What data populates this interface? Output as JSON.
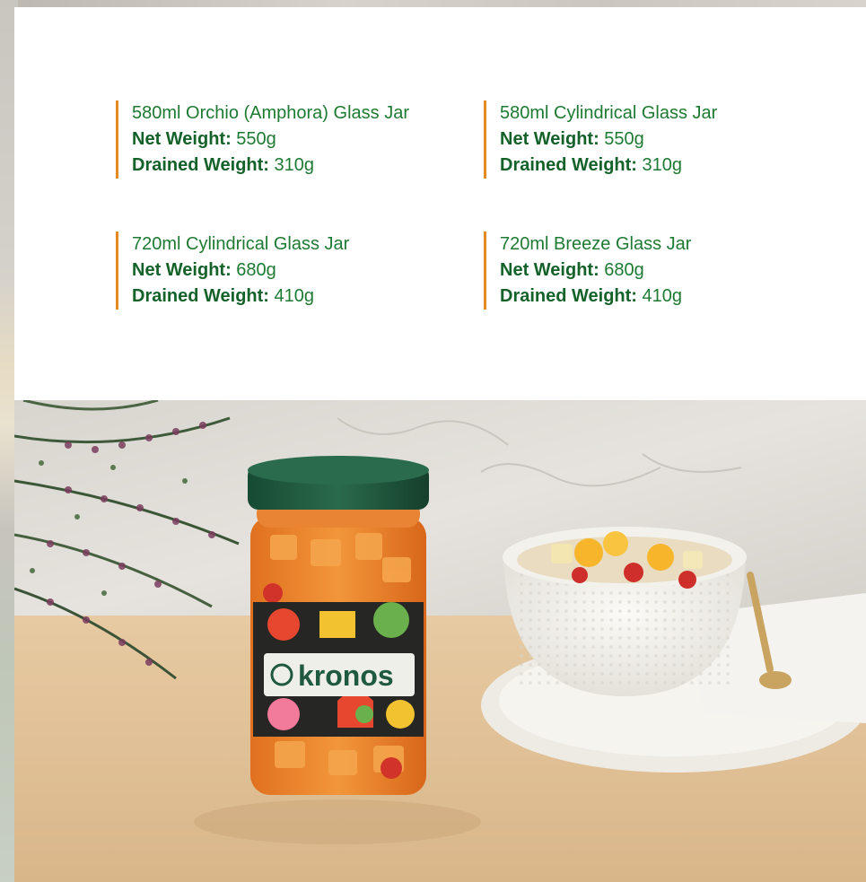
{
  "specs": [
    {
      "title": "580ml Orchio (Amphora) Glass Jar",
      "net_label": "Net Weight:",
      "net_value": "550g",
      "drained_label": "Drained Weight:",
      "drained_value": "310g"
    },
    {
      "title": "580ml Cylindrical Glass Jar",
      "net_label": "Net Weight:",
      "net_value": "550g",
      "drained_label": "Drained Weight:",
      "drained_value": "310g"
    },
    {
      "title": "720ml Cylindrical Glass Jar",
      "net_label": "Net Weight:",
      "net_value": "680g",
      "drained_label": "Drained Weight:",
      "drained_value": "410g"
    },
    {
      "title": "720ml Breeze Glass Jar",
      "net_label": "Net Weight:",
      "net_value": "680g",
      "drained_label": "Drained Weight:",
      "drained_value": "410g"
    }
  ],
  "photo": {
    "brand_label": "kronos"
  },
  "colors": {
    "accent_bar": "#e58a1f",
    "text_green": "#1e7a32",
    "lid_green": "#1f5a40",
    "table_tan": "#e2c49c"
  }
}
